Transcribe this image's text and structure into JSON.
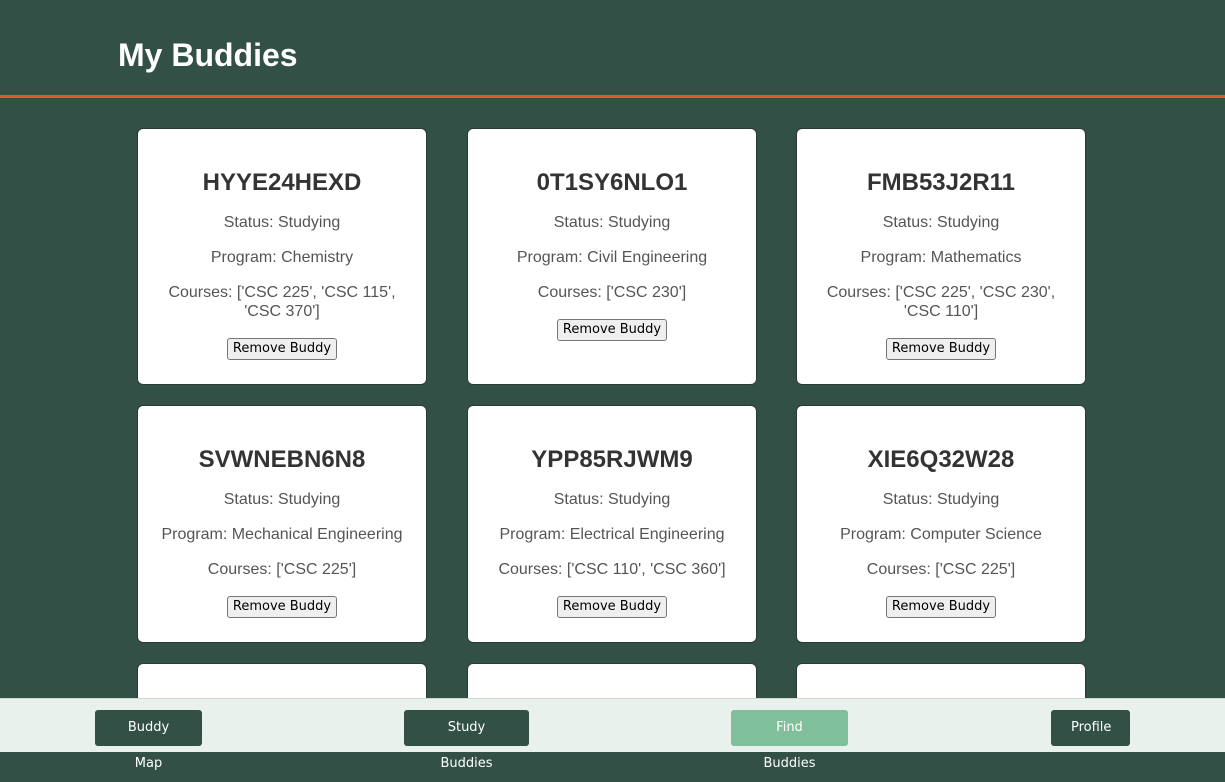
{
  "header": {
    "title": "My Buddies"
  },
  "labels": {
    "status_prefix": "Status: ",
    "program_prefix": "Program: ",
    "courses_prefix": "Courses: ",
    "remove_button": "Remove Buddy"
  },
  "buddies": [
    {
      "name": "HYYE24HEXD",
      "status": "Status: Studying",
      "program": "Program: Chemistry",
      "courses": "Courses: ['CSC 225', 'CSC 115', 'CSC 370']",
      "remove": "Remove Buddy"
    },
    {
      "name": "0T1SY6NLO1",
      "status": "Status: Studying",
      "program": "Program: Civil Engineering",
      "courses": "Courses: ['CSC 230']",
      "remove": "Remove Buddy"
    },
    {
      "name": "FMB53J2R11",
      "status": "Status: Studying",
      "program": "Program: Mathematics",
      "courses": "Courses: ['CSC 225', 'CSC 230', 'CSC 110']",
      "remove": "Remove Buddy"
    },
    {
      "name": "SVWNEBN6N8",
      "status": "Status: Studying",
      "program": "Program: Mechanical Engineering",
      "courses": "Courses: ['CSC 225']",
      "remove": "Remove Buddy"
    },
    {
      "name": "YPP85RJWM9",
      "status": "Status: Studying",
      "program": "Program: Electrical Engineering",
      "courses": "Courses: ['CSC 110', 'CSC 360']",
      "remove": "Remove Buddy"
    },
    {
      "name": "XIE6Q32W28",
      "status": "Status: Studying",
      "program": "Program: Computer Science",
      "courses": "Courses: ['CSC 225']",
      "remove": "Remove Buddy"
    }
  ],
  "nav": {
    "buddy_map": "Buddy Map",
    "study_buddies": "Study Buddies",
    "find_buddies": "Find Buddies",
    "profile": "Profile"
  }
}
